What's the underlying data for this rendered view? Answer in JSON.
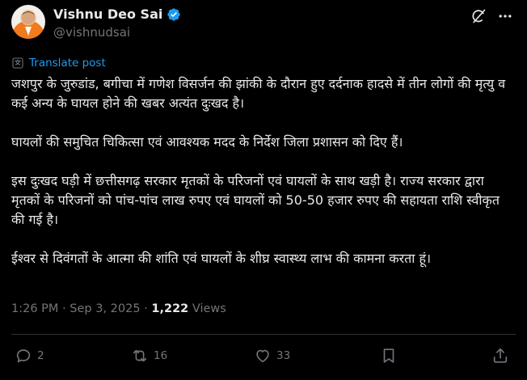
{
  "author": {
    "name": "Vishnu Deo Sai",
    "handle": "@vishnudsai",
    "verified": true
  },
  "icons": {
    "verified": "verified-badge-icon",
    "grok": "grok-icon",
    "more": "more-icon",
    "translate": "translate-icon",
    "reply": "reply-icon",
    "repost": "repost-icon",
    "like": "like-icon",
    "bookmark": "bookmark-icon",
    "share": "share-icon"
  },
  "translate_label": "Translate post",
  "paragraphs": [
    "जशपुर के जुरुडांड, बगीचा में गणेश विसर्जन की झांकी के दौरान हुए दर्दनाक हादसे में तीन लोगों की मृत्यु व कई अन्य के घायल होने की खबर अत्यंत दुःखद है।",
    "घायलों की समुचित चिकित्सा एवं आवश्यक मदद के निर्देश जिला प्रशासन को दिए हैं।",
    "इस दुःखद घड़ी में छत्तीसगढ़ सरकार मृतकों के परिजनों एवं घायलों के साथ खड़ी है। राज्य सरकार द्वारा मृतकों के परिजनों को पांच-पांच लाख रुपए एवं घायलों को 50-50 हजार रुपए की सहायता राशि स्वीकृत की गई है।",
    "ईश्वर से दिवंगतों के आत्मा की शांति एवं घायलों के शीघ्र स्वास्थ्य लाभ की कामना करता हूं।"
  ],
  "meta": {
    "time": "1:26 PM",
    "separator": "·",
    "date": "Sep 3, 2025",
    "views_count": "1,222",
    "views_label": "Views"
  },
  "actions": {
    "reply_count": "2",
    "repost_count": "16",
    "like_count": "33"
  },
  "colors": {
    "background": "#000000",
    "text": "#e7e9ea",
    "secondary": "#71767b",
    "accent": "#1d9bf0"
  }
}
